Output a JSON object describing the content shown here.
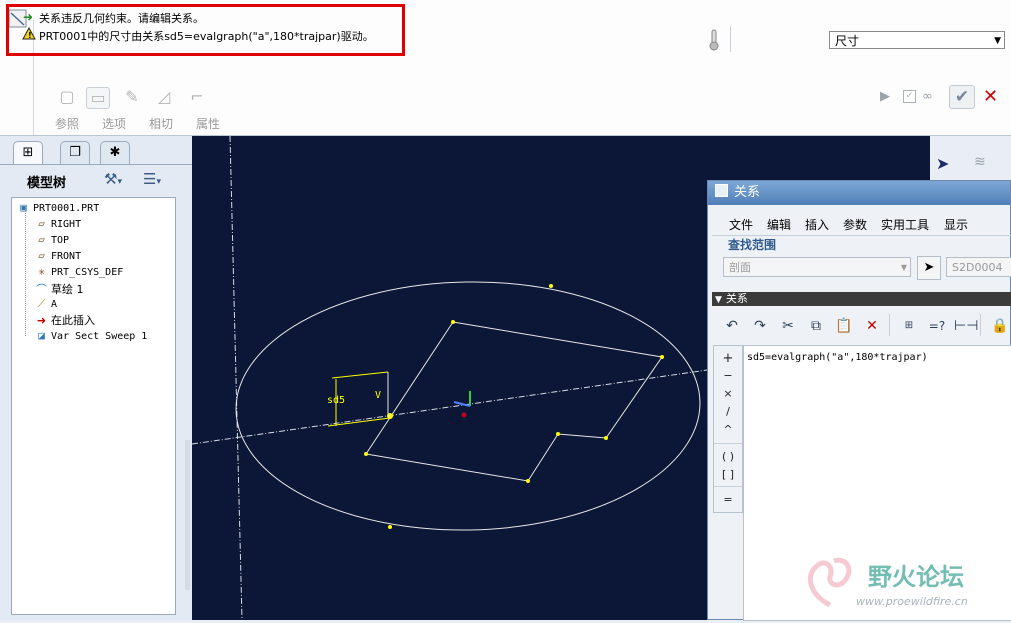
{
  "messages": [
    {
      "icon": "arrow-icon",
      "text": "关系违反几何约束。请编辑关系。"
    },
    {
      "icon": "warning-icon",
      "text": "PRT0001中的尺寸由关系sd5=evalgraph(\"a\",180*trajpar)驱动。"
    }
  ],
  "dim_select": {
    "value": "尺寸"
  },
  "dashboard_tabs": [
    {
      "label": "参照",
      "icon": "reference-icon"
    },
    {
      "label": "选项",
      "icon": "options-icon"
    },
    {
      "label": "相切",
      "icon": "tangent-icon"
    },
    {
      "label": "属性",
      "icon": "properties-icon"
    }
  ],
  "model_tree": {
    "title": "模型树",
    "nodes": [
      {
        "label": "PRT0001.PRT",
        "icon": "part-icon"
      },
      {
        "label": "RIGHT",
        "icon": "datum-plane-icon"
      },
      {
        "label": "TOP",
        "icon": "datum-plane-icon"
      },
      {
        "label": "FRONT",
        "icon": "datum-plane-icon"
      },
      {
        "label": "PRT_CSYS_DEF",
        "icon": "csys-icon"
      },
      {
        "label": "草绘 1",
        "icon": "sketch-icon"
      },
      {
        "label": "A",
        "icon": "graph-icon"
      },
      {
        "label": "在此插入",
        "icon": "insert-here-icon"
      },
      {
        "label": "Var Sect Sweep 1",
        "icon": "sweep-icon"
      }
    ]
  },
  "sketch": {
    "dim_label": "sd5",
    "v_label": "V"
  },
  "relations": {
    "title": "关系",
    "menu": [
      "文件",
      "编辑",
      "插入",
      "参数",
      "实用工具",
      "显示"
    ],
    "lookup_label": "查找范围",
    "scope_value": "剖面",
    "section_value": "S2D0004",
    "relations_label": "关系",
    "text": "sd5=evalgraph(\"a\",180*trajpar)",
    "operators": [
      "+",
      "−",
      "×",
      "/",
      "^",
      "( )",
      "[ ]",
      "="
    ]
  },
  "watermark": {
    "title": "野火论坛",
    "url": "www.proewildfire.cn"
  },
  "colors": {
    "accent": "#e00000",
    "graphics_bg": "#0c1738",
    "sketch": "#ffffff",
    "points": "#ffff00"
  }
}
